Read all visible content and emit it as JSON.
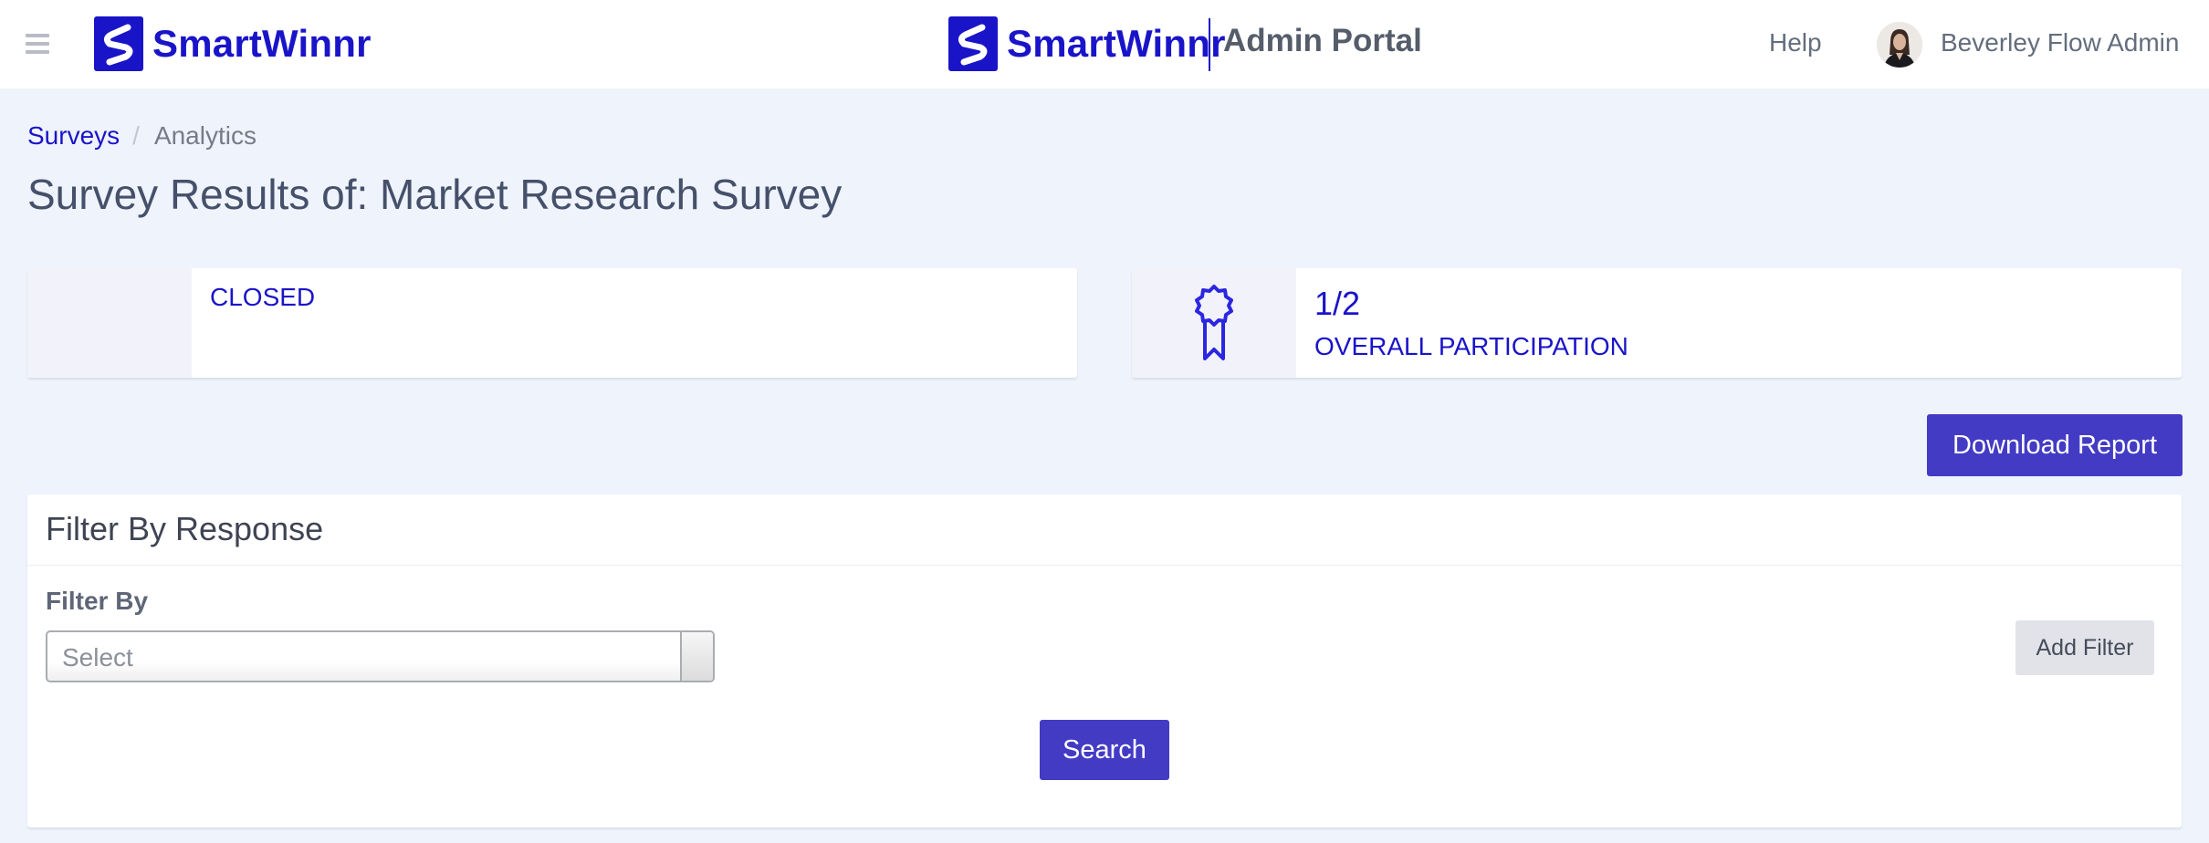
{
  "header": {
    "brand": "SmartWinnr",
    "portal_title": "Admin Portal",
    "help_label": "Help",
    "user_name": "Beverley Flow Admin"
  },
  "breadcrumb": {
    "root": "Surveys",
    "separator": "/",
    "current": "Analytics"
  },
  "page": {
    "title": "Survey Results of: Market Research Survey"
  },
  "stats": {
    "status": "CLOSED",
    "participation_value": "1/2",
    "participation_label": "OVERALL PARTICIPATION"
  },
  "actions": {
    "download_report": "Download Report"
  },
  "filter": {
    "panel_title": "Filter By Response",
    "label": "Filter By",
    "select_placeholder": "Select",
    "add_filter": "Add Filter",
    "search": "Search"
  },
  "colors": {
    "brand": "#1a14c9",
    "primary_button": "#433bc4",
    "background": "#eff3fb"
  },
  "icons": {
    "menu": "hamburger-icon",
    "logo": "smartwinnr-logo-icon",
    "participation": "award-ribbon-icon"
  }
}
